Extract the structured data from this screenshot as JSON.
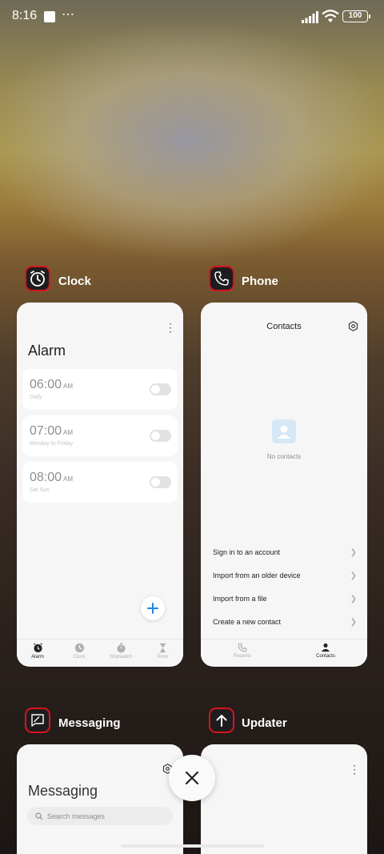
{
  "status_bar": {
    "time": "8:16",
    "more": "⋯",
    "battery": "100"
  },
  "apps": [
    {
      "name": "Clock",
      "icon": "alarm-clock-icon",
      "screen": {
        "title": "Alarm",
        "alarms": [
          {
            "time": "06:00",
            "ampm": "AM",
            "repeat": "Daily"
          },
          {
            "time": "07:00",
            "ampm": "AM",
            "repeat": "Monday to Friday"
          },
          {
            "time": "08:00",
            "ampm": "AM",
            "repeat": "Sat Sun"
          }
        ],
        "tabs": [
          {
            "label": "Alarm",
            "icon": "alarm-clock-icon",
            "active": true
          },
          {
            "label": "Clock",
            "icon": "clock-icon",
            "active": false
          },
          {
            "label": "Stopwatch",
            "icon": "stopwatch-icon",
            "active": false
          },
          {
            "label": "Timer",
            "icon": "hourglass-icon",
            "active": false
          }
        ]
      }
    },
    {
      "name": "Phone",
      "icon": "phone-icon",
      "screen": {
        "title": "Contacts",
        "empty_text": "No contacts",
        "menu": [
          "Sign in to an account",
          "Import from an older device",
          "Import from a file",
          "Create a new contact"
        ],
        "tabs": [
          {
            "label": "Recents",
            "icon": "phone-icon",
            "active": false
          },
          {
            "label": "Contacts",
            "icon": "person-icon",
            "active": true
          }
        ]
      }
    },
    {
      "name": "Messaging",
      "icon": "chat-bubble-icon",
      "screen": {
        "title": "Messaging",
        "search_placeholder": "Search messages"
      }
    },
    {
      "name": "Updater",
      "icon": "arrow-up-icon",
      "screen": {}
    }
  ],
  "colors": {
    "icon_border": "#d9131f",
    "fab_plus": "#1e88e5",
    "empty_contacts": "#d6e8f6"
  }
}
